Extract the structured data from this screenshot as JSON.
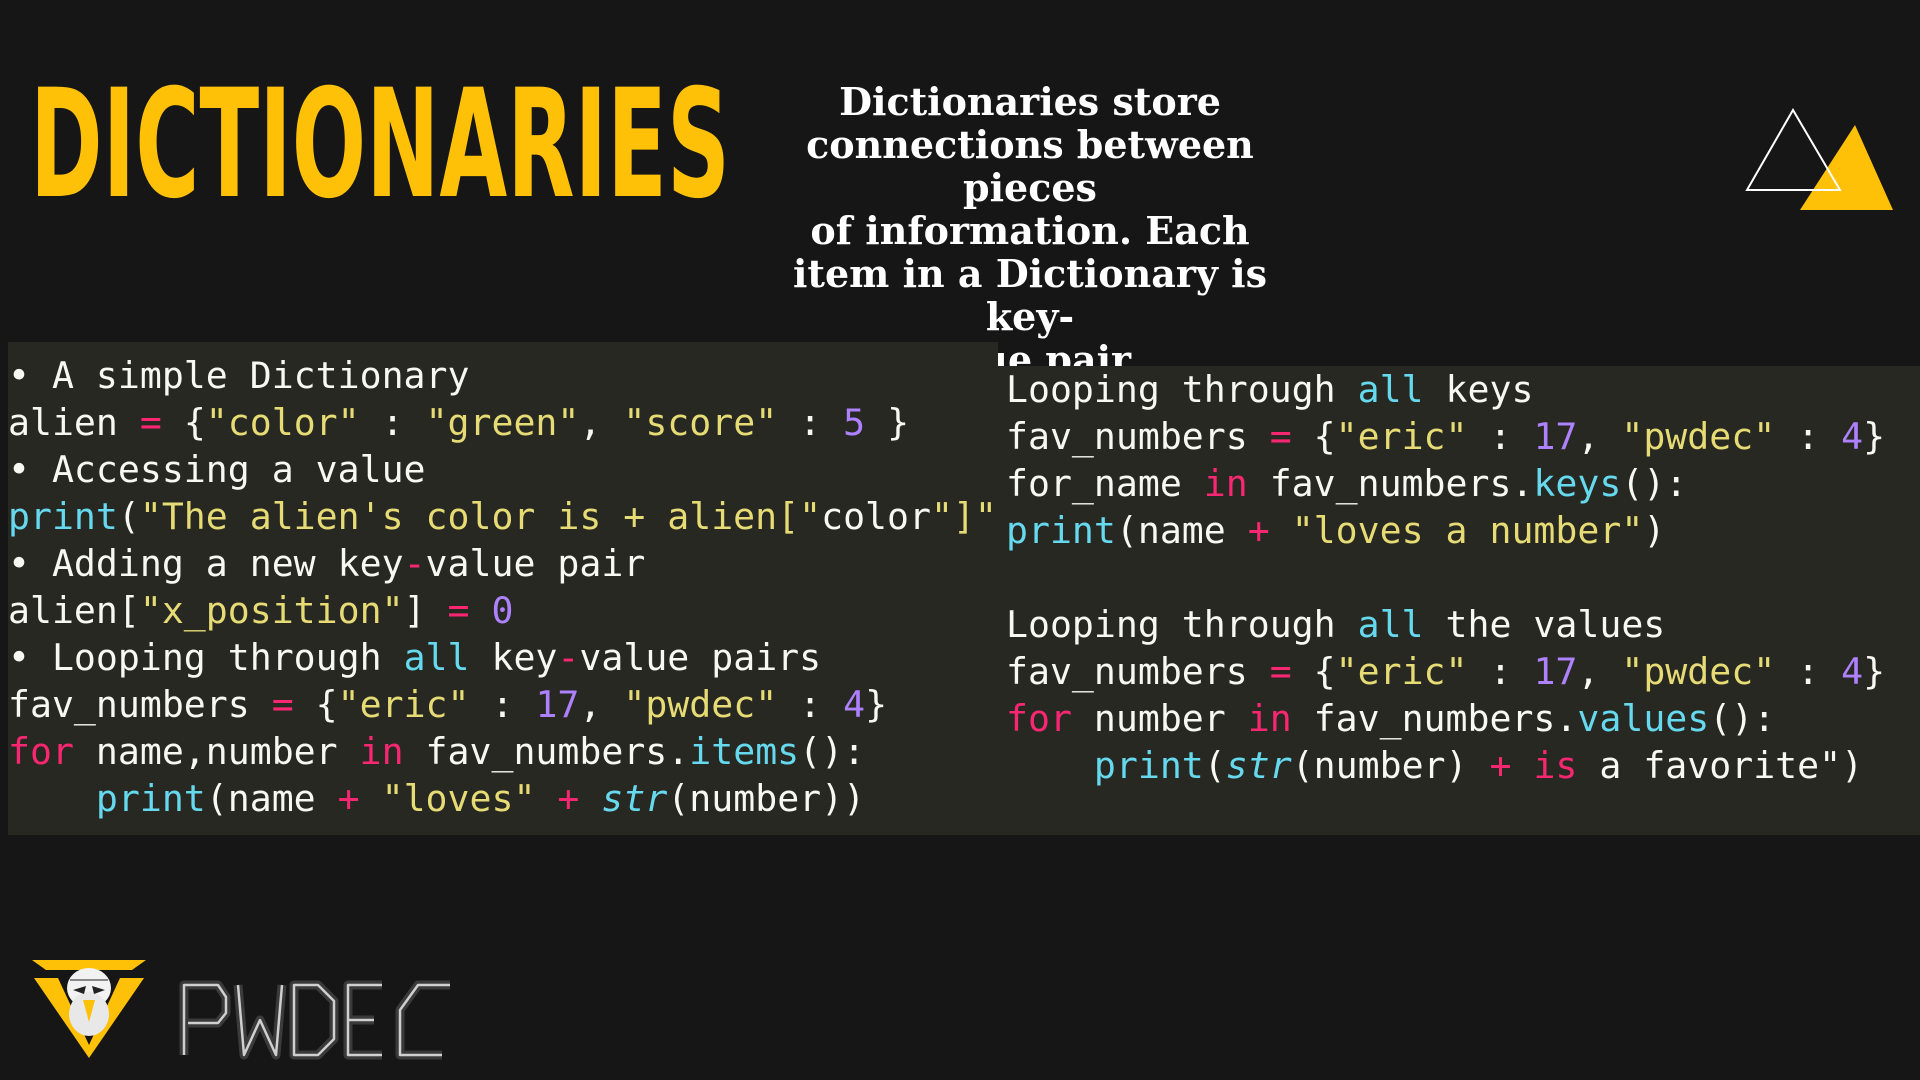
{
  "title": "DICTIONARIES",
  "subtitle_lines": [
    "Dictionaries store connections between pieces",
    "of information. Each item in a Dictionary is key-",
    "value pair."
  ],
  "colors": {
    "background": "#161616",
    "accent": "#ffc107",
    "code_background": "#272822",
    "code_text": "#f8f8f2",
    "string": "#e6db74",
    "number": "#ae81ff",
    "keyword": "#f92672",
    "function": "#66d9ef"
  },
  "icons": [
    "triangle-decoration-icon",
    "eagle-emblem-icon"
  ],
  "logo_text": "PWDEC",
  "left_code": [
    [
      [
        "• A simple Dictionary",
        "plain"
      ]
    ],
    [
      [
        "alien ",
        "plain"
      ],
      [
        "=",
        "op"
      ],
      [
        " {",
        "plain"
      ],
      [
        "\"color\"",
        "str"
      ],
      [
        " : ",
        "plain"
      ],
      [
        "\"green\"",
        "str"
      ],
      [
        ", ",
        "plain"
      ],
      [
        "\"score\"",
        "str"
      ],
      [
        " : ",
        "plain"
      ],
      [
        "5",
        "num"
      ],
      [
        " }",
        "plain"
      ]
    ],
    [
      [
        "• Accessing a value",
        "plain"
      ]
    ],
    [
      [
        "print",
        "fn"
      ],
      [
        "(",
        "plain"
      ],
      [
        "\"The alien's color is + alien[\"",
        "str"
      ],
      [
        "color",
        "plain"
      ],
      [
        "\"]\"",
        "str"
      ]
    ],
    [
      [
        "• Adding a new key",
        "plain"
      ],
      [
        "-",
        "op"
      ],
      [
        "value pair",
        "plain"
      ]
    ],
    [
      [
        "alien[",
        "plain"
      ],
      [
        "\"x_position\"",
        "str"
      ],
      [
        "] ",
        "plain"
      ],
      [
        "=",
        "op"
      ],
      [
        " ",
        "plain"
      ],
      [
        "0",
        "num"
      ]
    ],
    [
      [
        "• Looping through ",
        "plain"
      ],
      [
        "all",
        "fn"
      ],
      [
        " key",
        "plain"
      ],
      [
        "-",
        "op"
      ],
      [
        "value pairs",
        "plain"
      ]
    ],
    [
      [
        "fav_numbers ",
        "plain"
      ],
      [
        "=",
        "op"
      ],
      [
        " {",
        "plain"
      ],
      [
        "\"eric\"",
        "str"
      ],
      [
        " : ",
        "plain"
      ],
      [
        "17",
        "num"
      ],
      [
        ", ",
        "plain"
      ],
      [
        "\"pwdec\"",
        "str"
      ],
      [
        " : ",
        "plain"
      ],
      [
        "4",
        "num"
      ],
      [
        "}",
        "plain"
      ]
    ],
    [
      [
        "for",
        "kw"
      ],
      [
        " name,number ",
        "plain"
      ],
      [
        "in",
        "kw"
      ],
      [
        " fav_numbers.",
        "plain"
      ],
      [
        "items",
        "fn"
      ],
      [
        "():",
        "plain"
      ]
    ],
    [
      [
        "    ",
        "plain"
      ],
      [
        "print",
        "fn"
      ],
      [
        "(name ",
        "plain"
      ],
      [
        "+",
        "op"
      ],
      [
        " ",
        "plain"
      ],
      [
        "\"loves\"",
        "str"
      ],
      [
        " ",
        "plain"
      ],
      [
        "+",
        "op"
      ],
      [
        " ",
        "plain"
      ],
      [
        "str",
        "fni"
      ],
      [
        "(number))",
        "plain"
      ]
    ]
  ],
  "right_code": [
    [
      [
        "Looping through ",
        "plain"
      ],
      [
        "all",
        "fn"
      ],
      [
        " keys",
        "plain"
      ]
    ],
    [
      [
        "fav_numbers ",
        "plain"
      ],
      [
        "=",
        "op"
      ],
      [
        " {",
        "plain"
      ],
      [
        "\"eric\"",
        "str"
      ],
      [
        " : ",
        "plain"
      ],
      [
        "17",
        "num"
      ],
      [
        ", ",
        "plain"
      ],
      [
        "\"pwdec\"",
        "str"
      ],
      [
        " : ",
        "plain"
      ],
      [
        "4",
        "num"
      ],
      [
        "}",
        "plain"
      ]
    ],
    [
      [
        "for_name ",
        "plain"
      ],
      [
        "in",
        "kw"
      ],
      [
        " fav_numbers.",
        "plain"
      ],
      [
        "keys",
        "fn"
      ],
      [
        "():",
        "plain"
      ]
    ],
    [
      [
        "print",
        "fn"
      ],
      [
        "(name ",
        "plain"
      ],
      [
        "+",
        "op"
      ],
      [
        " ",
        "plain"
      ],
      [
        "\"loves a number\"",
        "str"
      ],
      [
        ")",
        "plain"
      ]
    ],
    [],
    [
      [
        "Looping through ",
        "plain"
      ],
      [
        "all",
        "fn"
      ],
      [
        " the values",
        "plain"
      ]
    ],
    [
      [
        "fav_numbers ",
        "plain"
      ],
      [
        "=",
        "op"
      ],
      [
        " {",
        "plain"
      ],
      [
        "\"eric\"",
        "str"
      ],
      [
        " : ",
        "plain"
      ],
      [
        "17",
        "num"
      ],
      [
        ", ",
        "plain"
      ],
      [
        "\"pwdec\"",
        "str"
      ],
      [
        " : ",
        "plain"
      ],
      [
        "4",
        "num"
      ],
      [
        "}",
        "plain"
      ]
    ],
    [
      [
        "for",
        "kw"
      ],
      [
        " number ",
        "plain"
      ],
      [
        "in",
        "kw"
      ],
      [
        " fav_numbers.",
        "plain"
      ],
      [
        "values",
        "fn"
      ],
      [
        "():",
        "plain"
      ]
    ],
    [
      [
        "    ",
        "plain"
      ],
      [
        "print",
        "fn"
      ],
      [
        "(",
        "plain"
      ],
      [
        "str",
        "fni"
      ],
      [
        "(number) ",
        "plain"
      ],
      [
        "+",
        "op"
      ],
      [
        " ",
        "plain"
      ],
      [
        "is",
        "kw"
      ],
      [
        " a favorite\")",
        "plain"
      ]
    ]
  ]
}
